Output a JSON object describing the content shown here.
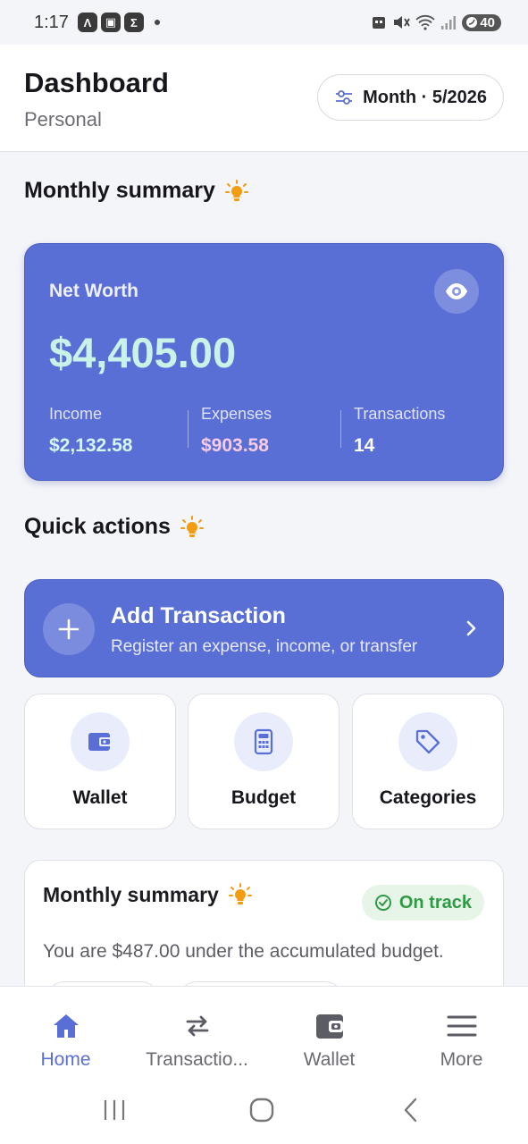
{
  "status_bar": {
    "time": "1:17",
    "battery": "40"
  },
  "header": {
    "title": "Dashboard",
    "subtitle": "Personal",
    "period_label": "Month · 5/2026"
  },
  "sections": {
    "summary_title": "Monthly summary",
    "quick_actions_title": "Quick actions"
  },
  "net_worth": {
    "label": "Net Worth",
    "amount": "$4,405.00",
    "stats": [
      {
        "label": "Income",
        "value": "$2,132.58"
      },
      {
        "label": "Expenses",
        "value": "$903.58"
      },
      {
        "label": "Transactions",
        "value": "14"
      }
    ]
  },
  "add_transaction": {
    "title": "Add Transaction",
    "subtitle": "Register an expense, income, or transfer"
  },
  "tiles": [
    {
      "label": "Wallet",
      "icon": "wallet-icon"
    },
    {
      "label": "Budget",
      "icon": "calculator-icon"
    },
    {
      "label": "Categories",
      "icon": "tag-icon"
    }
  ],
  "summary_card": {
    "title": "Monthly summary",
    "badge": "On track",
    "text": "You are $487.00 under the accumulated budget."
  },
  "bottom_nav": [
    {
      "label": "Home",
      "icon": "home-icon",
      "active": true
    },
    {
      "label": "Transactio...",
      "icon": "transfer-arrows-icon",
      "active": false
    },
    {
      "label": "Wallet",
      "icon": "wallet-icon",
      "active": false
    },
    {
      "label": "More",
      "icon": "menu-icon",
      "active": false
    }
  ],
  "colors": {
    "primary": "#5a6fd6",
    "net_amount": "#c9f3e9",
    "expense_value": "#f6cbe6",
    "on_track": "#2f9a44",
    "tip_bulb": "#f39c12",
    "background": "#f4f5f9"
  }
}
